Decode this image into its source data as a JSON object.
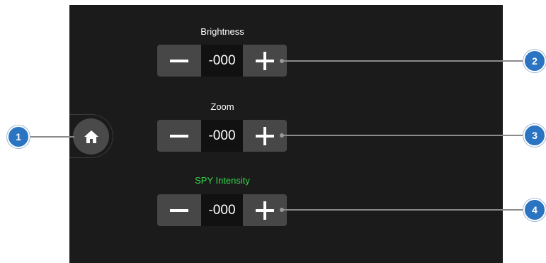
{
  "controls": {
    "brightness": {
      "label": "Brightness",
      "value": "-000"
    },
    "zoom": {
      "label": "Zoom",
      "value": "-000"
    },
    "spy_intensity": {
      "label": "SPY Intensity",
      "value": "-000"
    }
  },
  "callouts": [
    "1",
    "2",
    "3",
    "4"
  ],
  "icons": {
    "home": "home-icon",
    "decrease": "minus-icon",
    "increase": "plus-icon"
  },
  "colors": {
    "panel_background": "#1b1b1b",
    "stepper_background": "#474747",
    "value_background": "#111111",
    "accent_green": "#34d64a",
    "callout_blue": "#2b74c2"
  }
}
